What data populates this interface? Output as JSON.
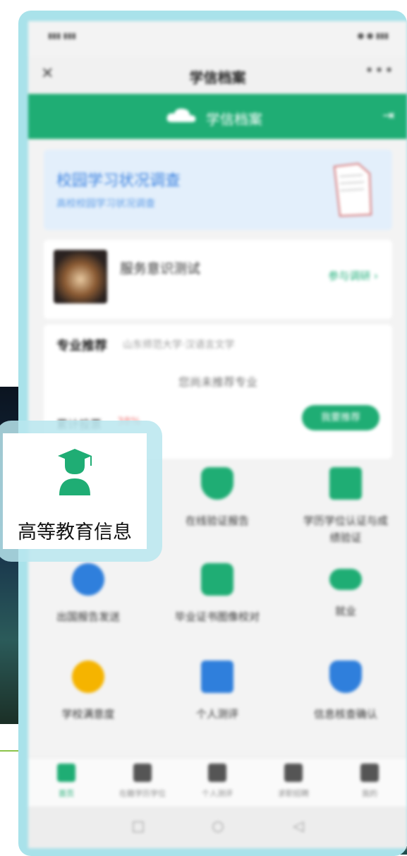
{
  "phone": {
    "title": "学信档案",
    "section_name": "学信档案",
    "banner": {
      "title": "校园学习状况调查",
      "subtitle": "高校校园学习状况调查"
    },
    "user": {
      "name": "服务意识测试",
      "link": "参与调研 ›"
    },
    "major": {
      "label": "专业推荐",
      "school": "山东师范大学·汉语言文学",
      "empty": "您尚未推荐专业",
      "progress_label": "累计投票",
      "progress_value": "38%",
      "button": "我要推荐"
    },
    "grid": [
      {
        "label": "",
        "color": "#f4f4f4"
      },
      {
        "label": "在线验证报告",
        "color": "#1fad74"
      },
      {
        "label": "学历学位认证与成绩验证",
        "color": "#1fad74"
      },
      {
        "label": "出国报告发送",
        "color": "#2f7fdc"
      },
      {
        "label": "毕业证书图像校对",
        "color": "#1fad74"
      },
      {
        "label": "就业",
        "color": "#1fad74"
      },
      {
        "label": "学校满意度",
        "color": "#f5b400"
      },
      {
        "label": "个人测评",
        "color": "#2f7fdc"
      },
      {
        "label": "信息核查确认",
        "color": "#2f7fdc"
      }
    ],
    "tabs": [
      {
        "label": "首页",
        "active": true
      },
      {
        "label": "在籍学历学位",
        "active": false
      },
      {
        "label": "个人测评",
        "active": false
      },
      {
        "label": "求职招聘",
        "active": false
      },
      {
        "label": "我的",
        "active": false
      }
    ]
  },
  "overlay": {
    "label": "高等教育信息",
    "icon": "graduate-icon"
  }
}
